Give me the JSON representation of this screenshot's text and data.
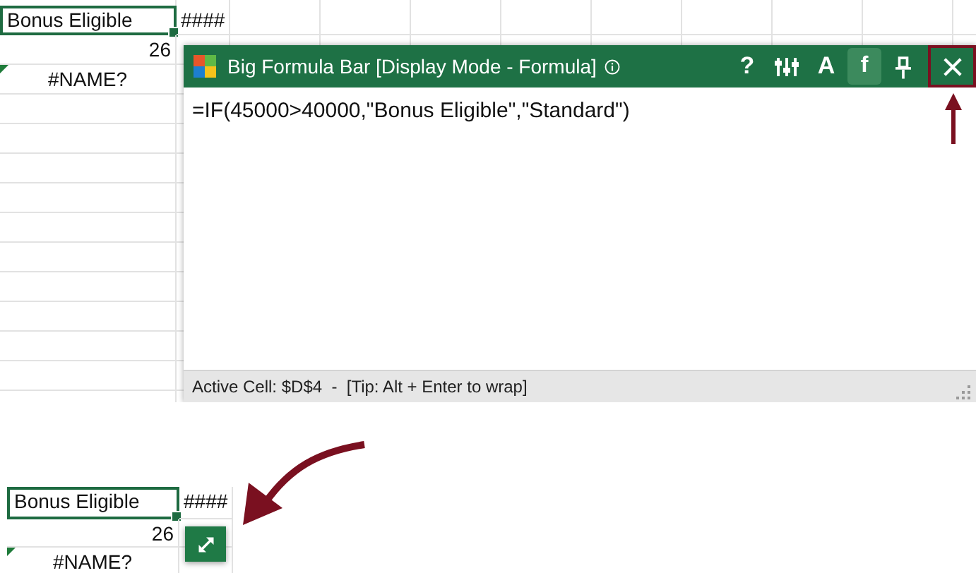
{
  "top_sheet": {
    "rows": [
      [
        {
          "text": "Bonus Eligible",
          "kind": "text",
          "selected": true
        },
        {
          "text": "####",
          "kind": "text",
          "selected": false
        }
      ],
      [
        {
          "text": "26",
          "kind": "number",
          "selected": false
        },
        {
          "text": "",
          "kind": "empty",
          "selected": false
        }
      ],
      [
        {
          "text": "#NAME?",
          "kind": "error",
          "selected": false
        },
        {
          "text": "",
          "kind": "empty",
          "selected": false
        }
      ]
    ]
  },
  "formula_window": {
    "title": "Big Formula Bar [Display Mode - Formula]",
    "toolbar": [
      {
        "kind": "help",
        "label": "?",
        "selected": false,
        "highlighted": false
      },
      {
        "kind": "settings",
        "selected": false,
        "highlighted": false
      },
      {
        "kind": "font",
        "label": "A",
        "selected": false,
        "highlighted": false
      },
      {
        "kind": "formula",
        "label": "f",
        "selected": true,
        "highlighted": false
      },
      {
        "kind": "pin",
        "selected": false,
        "highlighted": false
      },
      {
        "kind": "close",
        "selected": false,
        "highlighted": true
      }
    ],
    "formula": "=IF(45000>40000,\"Bonus Eligible\",\"Standard\")",
    "status": "Active Cell: $D$4  -  [Tip: Alt + Enter to wrap]"
  },
  "bottom_sheet": {
    "rows": [
      [
        {
          "text": "Bonus Eligible",
          "kind": "text",
          "selected": true
        },
        {
          "text": "####",
          "kind": "text",
          "selected": false
        }
      ],
      [
        {
          "text": "26",
          "kind": "number",
          "selected": false
        },
        {
          "text": "",
          "kind": "empty",
          "selected": false
        }
      ],
      [
        {
          "text": "#NAME?",
          "kind": "error",
          "selected": false
        },
        {
          "text": "",
          "kind": "empty",
          "selected": false
        }
      ]
    ]
  }
}
